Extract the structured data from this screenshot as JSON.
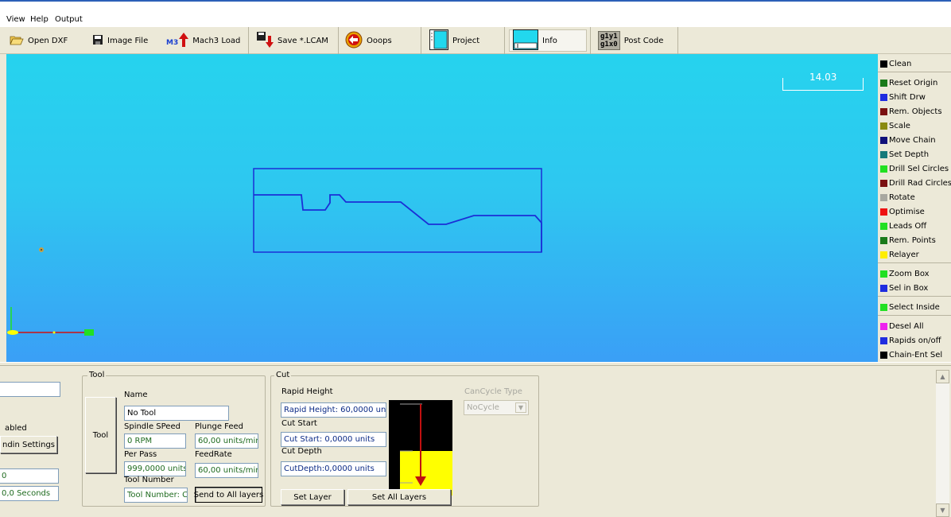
{
  "menu": {
    "items": [
      "View",
      "Help",
      "Output"
    ]
  },
  "toolbar": {
    "open_dxf": "Open DXF",
    "image_file": "Image File",
    "mach3_prefix": "M3",
    "mach3_load": "Mach3 Load",
    "save_lcam": "Save *.LCAM",
    "ooops": "Ooops",
    "project": "Project",
    "info": "Info",
    "gcode_icon_line1": "g1y1",
    "gcode_icon_line2": "g1x0",
    "post_code": "Post Code"
  },
  "canvas": {
    "scale_value": "14.03"
  },
  "right_panel": {
    "buttons": [
      {
        "label": "Clean",
        "color": "#000000"
      },
      {
        "label": "Reset Origin",
        "color": "#1a7a1a"
      },
      {
        "label": "Shift Drw",
        "color": "#1f2ce0"
      },
      {
        "label": "Rem. Objects",
        "color": "#7a1010"
      },
      {
        "label": "Scale",
        "color": "#8a8a10"
      },
      {
        "label": "Move Chain",
        "color": "#10107a"
      },
      {
        "label": "Set Depth",
        "color": "#157a7a"
      },
      {
        "label": "Drill Sel Circles",
        "color": "#22e022"
      },
      {
        "label": "Drill Rad Circles",
        "color": "#7a1010"
      },
      {
        "label": "Rotate",
        "color": "#a8a8a0"
      },
      {
        "label": "Optimise",
        "color": "#ee1111"
      },
      {
        "label": "Leads Off",
        "color": "#22e022"
      },
      {
        "label": "Rem. Points",
        "color": "#1a7a1a"
      },
      {
        "label": "Relayer",
        "color": "#ffee00"
      },
      {
        "label": "Zoom Box",
        "color": "#22e022"
      },
      {
        "label": "Sel in Box",
        "color": "#1f2ce0"
      },
      {
        "label": "Select Inside",
        "color": "#22e022"
      },
      {
        "label": "Desel All",
        "color": "#ee22ee"
      },
      {
        "label": "Rapids on/off",
        "color": "#1f2ce0"
      },
      {
        "label": "Chain-Ent Sel",
        "color": "#000000"
      }
    ]
  },
  "left_partial": {
    "enabled_label": "abled",
    "spindle_settings_button": "ndin Settings",
    "value_field": "0",
    "seconds_field": "0,0 Seconds"
  },
  "tool": {
    "group_title": "Tool",
    "tool_button": "Tool",
    "name_label": "Name",
    "name_value": "No Tool",
    "spindle_speed_label": "Spindle SPeed",
    "spindle_speed_value": "0 RPM",
    "plunge_feed_label": "Plunge Feed",
    "plunge_feed_value": "60,00 units/mir",
    "per_pass_label": "Per Pass",
    "per_pass_value": "999,0000 units",
    "feedrate_label": "FeedRate",
    "feedrate_value": "60,00 units/mir",
    "tool_number_label": "Tool Number",
    "tool_number_value": "Tool Number: C",
    "send_all_button": "Send to All layers"
  },
  "cut": {
    "group_title": "Cut",
    "rapid_height_label": "Rapid Height",
    "rapid_height_value": "Rapid Height: 60,0000 unil",
    "cut_start_label": "Cut Start",
    "cut_start_value": "Cut Start: 0,0000 units",
    "cut_depth_label": "Cut Depth",
    "cut_depth_value": "CutDepth:0,0000 units",
    "cancycle_label": "CanCycle Type",
    "cancycle_value": "NoCycle",
    "set_layer_button": "Set Layer",
    "set_all_layers_button": "Set All Layers"
  },
  "colors": {
    "accent_blue": "#1f2ce0",
    "profile_line": "#1b2fd6",
    "diagram_yellow": "#ffff00"
  }
}
